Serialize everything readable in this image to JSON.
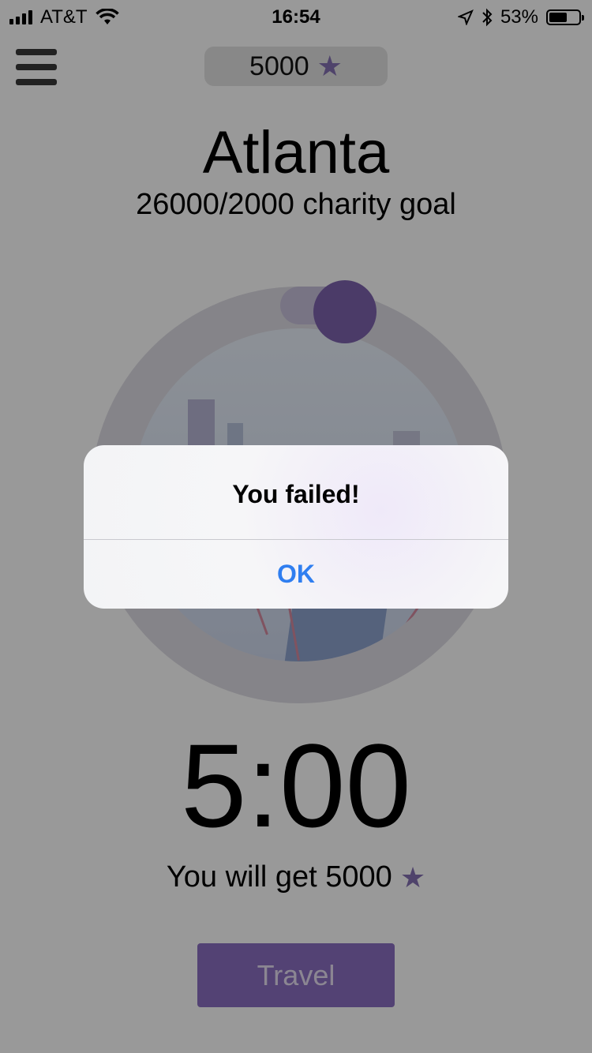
{
  "status_bar": {
    "carrier": "AT&T",
    "time": "16:54",
    "battery": "53%"
  },
  "header": {
    "points": "5000",
    "points_icon": "star-icon"
  },
  "city": {
    "name": "Atlanta",
    "goal_text": "26000/2000 charity goal"
  },
  "progress": {
    "ring_colors": {
      "track": "#dedde4",
      "knob": "#7d63ae"
    }
  },
  "timer": "5:00",
  "reward": {
    "text": "You will get 5000",
    "icon": "star-icon"
  },
  "travel_button": {
    "label": "Travel",
    "color": "#8a6fc2"
  },
  "alert": {
    "title": "You failed!",
    "ok_label": "OK",
    "ok_color": "#2f7ef0"
  }
}
